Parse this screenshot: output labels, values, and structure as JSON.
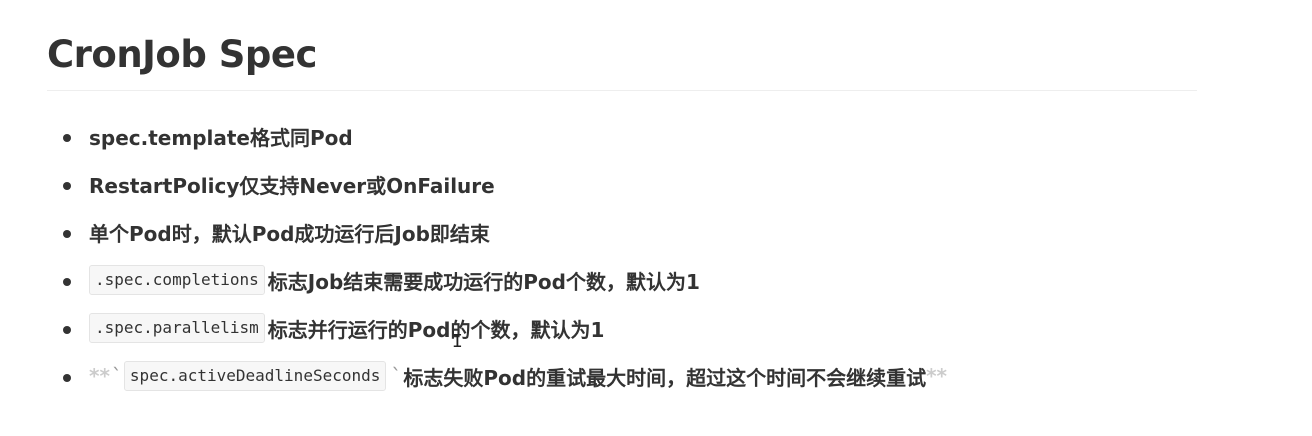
{
  "heading": "CronJob Spec",
  "items": [
    {
      "text": "spec.template格式同Pod"
    },
    {
      "text": "RestartPolicy仅支持Never或OnFailure"
    },
    {
      "text": "单个Pod时，默认Pod成功运行后Job即结束"
    },
    {
      "code": ".spec.completions",
      "text": "标志Job结束需要成功运行的Pod个数，默认为1"
    },
    {
      "code": ".spec.parallelism",
      "text": "标志并行运行的Pod的个数，默认为1"
    },
    {
      "prefix": "**",
      "backtick": "`",
      "code": "spec.activeDeadlineSeconds",
      "text": "标志失败Pod的重试最大时间，超过这个时间不会继续重试",
      "suffix": "**"
    }
  ]
}
